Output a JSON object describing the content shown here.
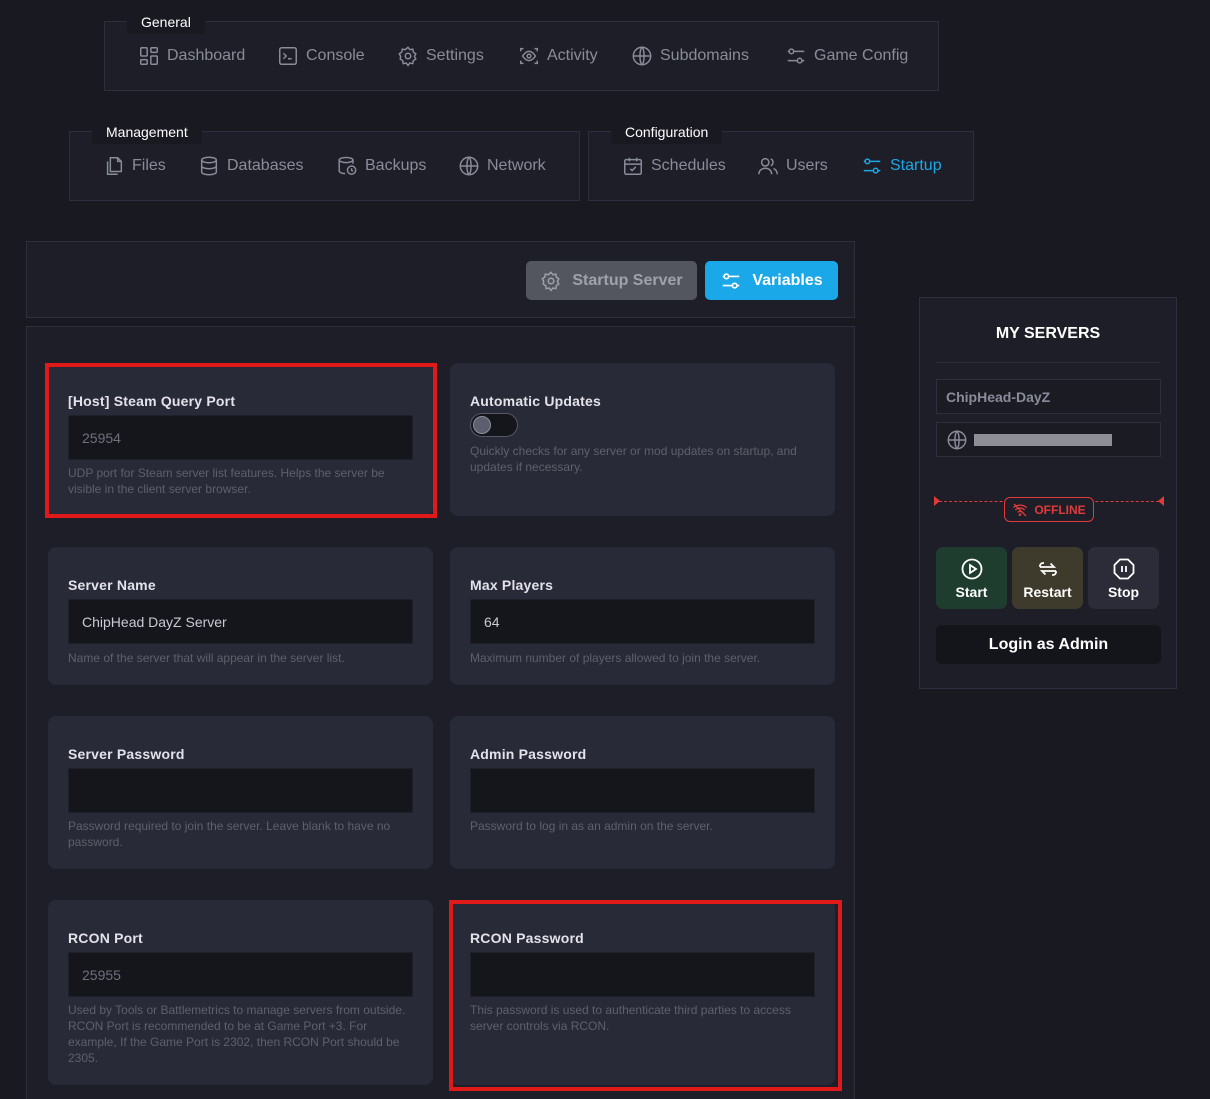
{
  "nav": {
    "general": {
      "legend": "General",
      "items": [
        {
          "label": "Dashboard",
          "icon": "dashboard-icon"
        },
        {
          "label": "Console",
          "icon": "console-icon"
        },
        {
          "label": "Settings",
          "icon": "gear-icon"
        },
        {
          "label": "Activity",
          "icon": "eye-icon"
        },
        {
          "label": "Subdomains",
          "icon": "globe-icon"
        },
        {
          "label": "Game Config",
          "icon": "sliders-icon"
        }
      ]
    },
    "management": {
      "legend": "Management",
      "items": [
        {
          "label": "Files",
          "icon": "files-icon"
        },
        {
          "label": "Databases",
          "icon": "database-icon"
        },
        {
          "label": "Backups",
          "icon": "backup-icon"
        },
        {
          "label": "Network",
          "icon": "globe-icon"
        }
      ]
    },
    "configuration": {
      "legend": "Configuration",
      "items": [
        {
          "label": "Schedules",
          "icon": "calendar-icon"
        },
        {
          "label": "Users",
          "icon": "users-icon"
        },
        {
          "label": "Startup",
          "icon": "sliders-icon",
          "active": true
        }
      ]
    }
  },
  "toolbar": {
    "startup_server_label": "Startup Server",
    "variables_label": "Variables"
  },
  "variables": {
    "steam_query_port": {
      "label": "[Host] Steam Query Port",
      "value": "25954",
      "description": "UDP port for Steam server list features. Helps the server be visible in the client server browser."
    },
    "automatic_updates": {
      "label": "Automatic Updates",
      "enabled": false,
      "description": "Quickly checks for any server or mod updates on startup, and updates if necessary."
    },
    "server_name": {
      "label": "Server Name",
      "value": "ChipHead DayZ Server",
      "description": "Name of the server that will appear in the server list."
    },
    "max_players": {
      "label": "Max Players",
      "value": "64",
      "description": "Maximum number of players allowed to join the server."
    },
    "server_password": {
      "label": "Server Password",
      "value": "",
      "description": "Password required to join the server. Leave blank to have no password."
    },
    "admin_password": {
      "label": "Admin Password",
      "value": "",
      "description": "Password to log in as an admin on the server."
    },
    "rcon_port": {
      "label": "RCON Port",
      "value": "25955",
      "description": "Used by Tools or Battlemetrics to manage servers from outside. RCON Port is recommended to be at Game Port +3. For example, If the Game Port is 2302, then RCON Port should be 2305."
    },
    "rcon_password": {
      "label": "RCON Password",
      "value": "",
      "description": "This password is used to authenticate third parties to access server controls via RCON."
    }
  },
  "my_servers": {
    "title": "MY SERVERS",
    "server_name": "ChipHead-DayZ",
    "status": "OFFLINE",
    "status_color": "#e03a3a",
    "start_label": "Start",
    "restart_label": "Restart",
    "stop_label": "Stop",
    "login_label": "Login as Admin"
  },
  "colors": {
    "accent": "#1ba8e8",
    "highlight_box": "#e01919",
    "start": "#1f3d2e",
    "restart": "#3e3a2c"
  }
}
